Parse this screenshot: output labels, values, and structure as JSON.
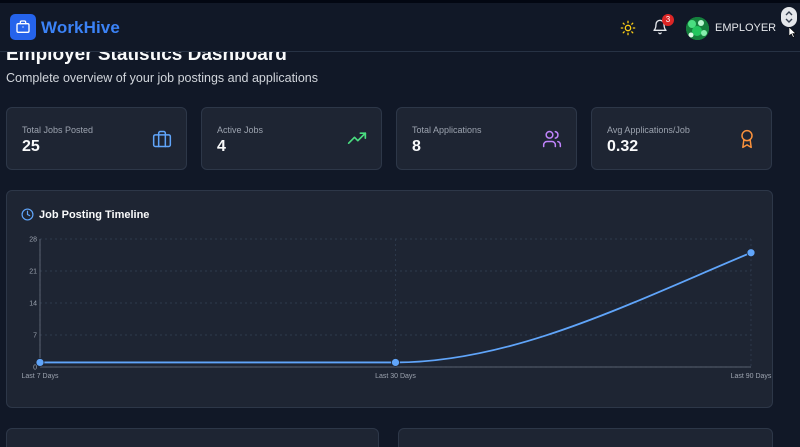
{
  "app": {
    "brand": "WorkHive",
    "notification_count": "3",
    "user_role": "EMPLOYER"
  },
  "header": {
    "title": "Employer Statistics Dashboard",
    "subtitle": "Complete overview of your job postings and applications"
  },
  "stats": [
    {
      "label": "Total Jobs Posted",
      "value": "25",
      "icon": "briefcase-icon",
      "color": "#60a5fa"
    },
    {
      "label": "Active Jobs",
      "value": "4",
      "icon": "trending-up-icon",
      "color": "#4ade80"
    },
    {
      "label": "Total Applications",
      "value": "8",
      "icon": "users-icon",
      "color": "#c084fc"
    },
    {
      "label": "Avg Applications/Job",
      "value": "0.32",
      "icon": "award-icon",
      "color": "#fb923c"
    }
  ],
  "timeline": {
    "title": "Job Posting Timeline"
  },
  "chart_data": {
    "type": "line",
    "title": "Job Posting Timeline",
    "categories": [
      "Last 7 Days",
      "Last 30 Days",
      "Last 90 Days"
    ],
    "series": [
      {
        "values": [
          1,
          1,
          25
        ]
      }
    ],
    "ylim": [
      0,
      28
    ],
    "yticks": [
      0,
      7,
      14,
      21,
      28
    ],
    "grid": true,
    "color": "#60a5fa"
  }
}
